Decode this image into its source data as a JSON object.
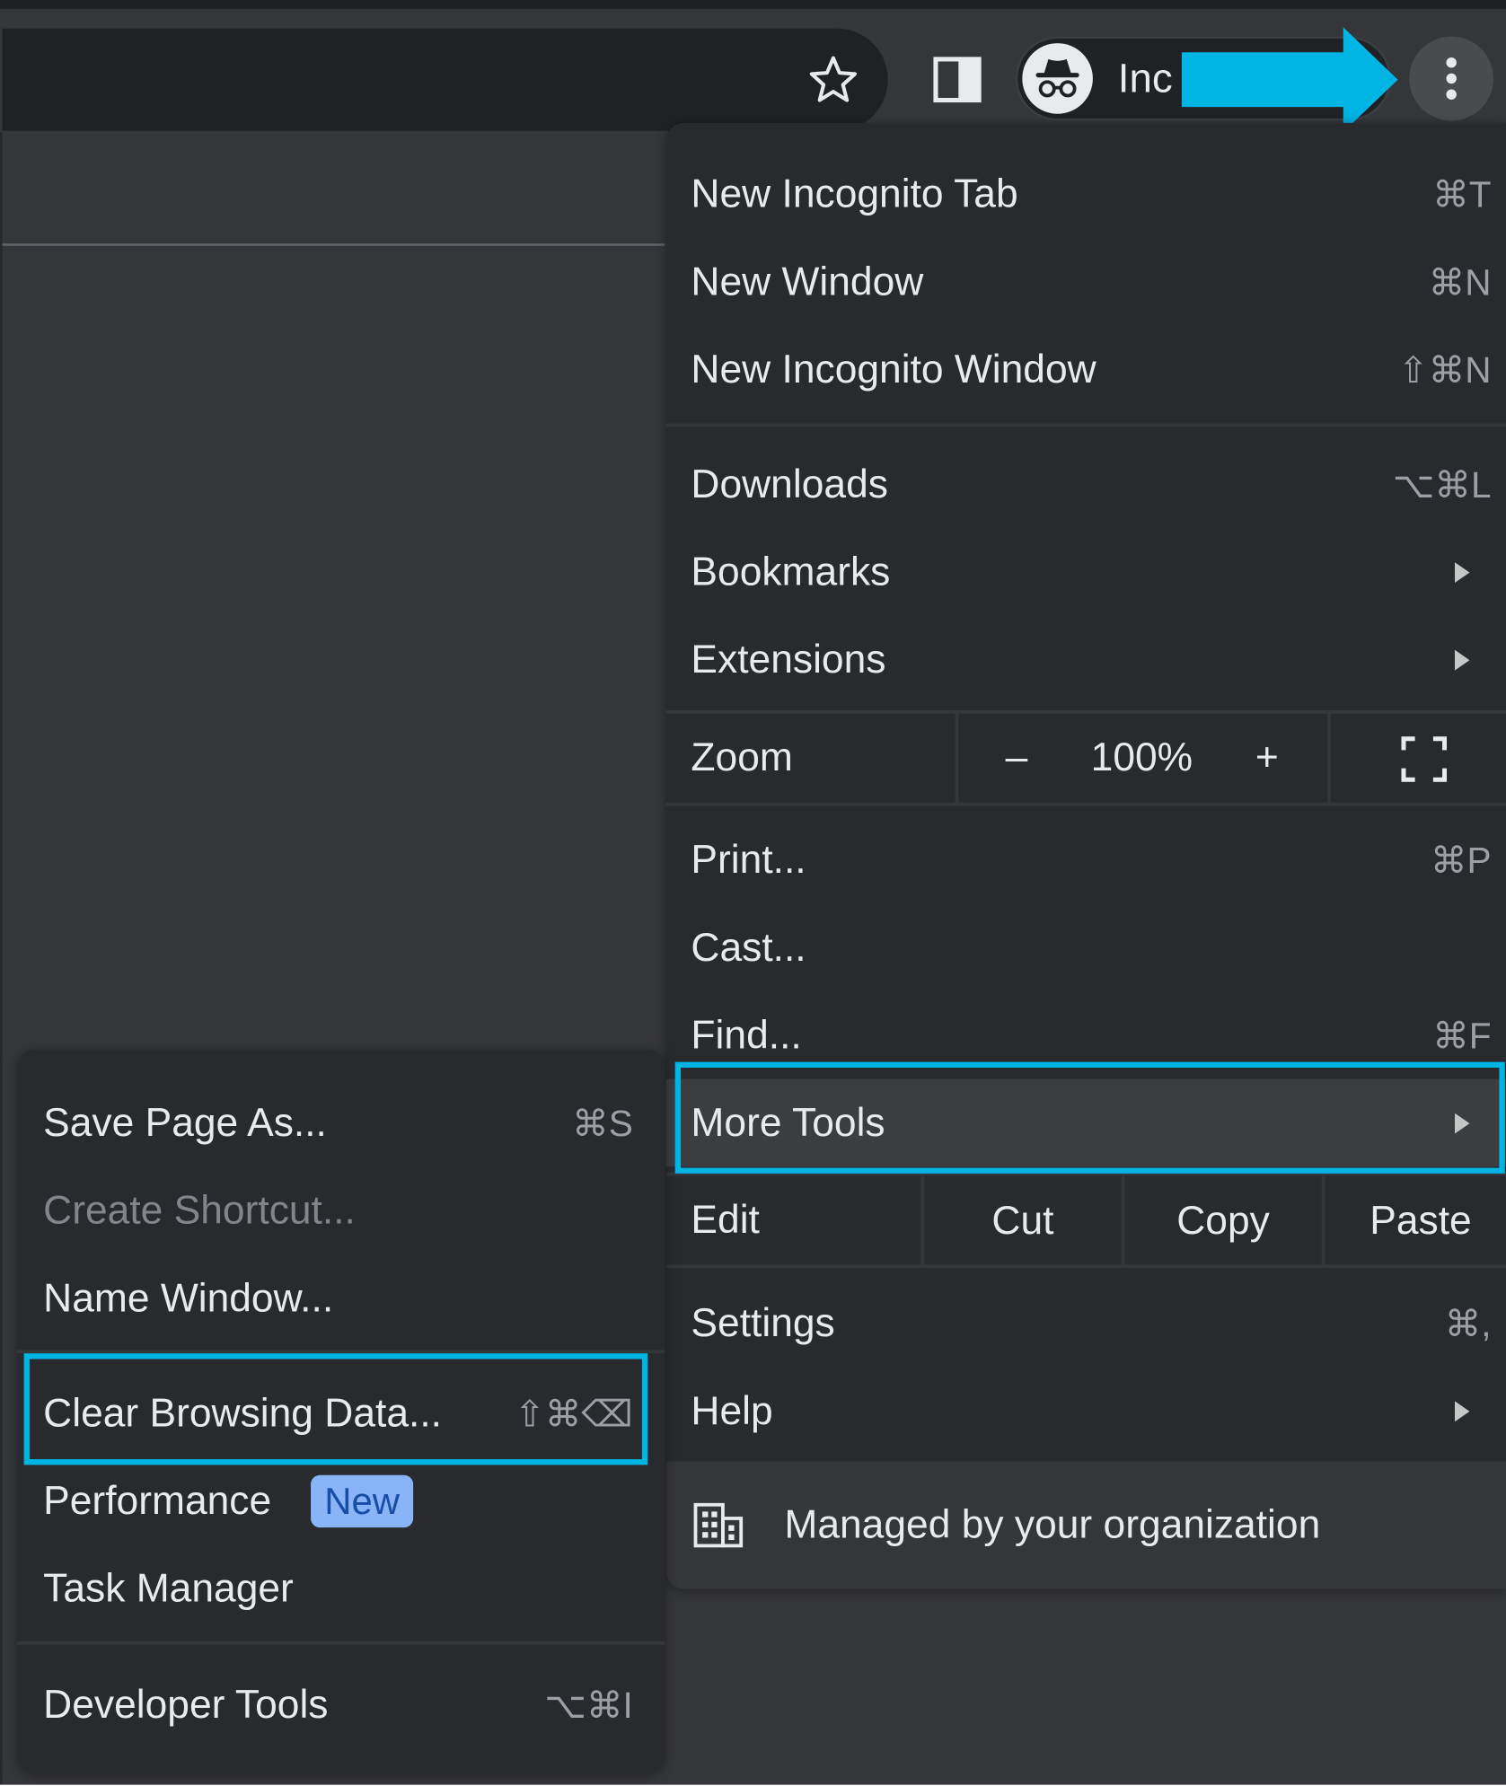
{
  "toolbar": {
    "profile_label": "Inc",
    "icons": [
      "star-icon",
      "side-panel-icon",
      "incognito-icon",
      "three-dot-menu-icon"
    ]
  },
  "main_menu": {
    "items": [
      {
        "label": "New Incognito Tab",
        "shortcut": "⌘T"
      },
      {
        "label": "New Window",
        "shortcut": "⌘N"
      },
      {
        "label": "New Incognito Window",
        "shortcut": "⇧⌘N"
      },
      {
        "label": "Downloads",
        "shortcut": "⌥⌘L"
      },
      {
        "label": "Bookmarks"
      },
      {
        "label": "Extensions"
      }
    ],
    "zoom": {
      "label": "Zoom",
      "minus": "–",
      "value": "100%",
      "plus": "+"
    },
    "items2": [
      {
        "label": "Print...",
        "shortcut": "⌘P"
      },
      {
        "label": "Cast..."
      },
      {
        "label": "Find...",
        "shortcut": "⌘F"
      },
      {
        "label": "More Tools"
      }
    ],
    "edit": {
      "label": "Edit",
      "cut": "Cut",
      "copy": "Copy",
      "paste": "Paste"
    },
    "items3": [
      {
        "label": "Settings",
        "shortcut": "⌘,"
      },
      {
        "label": "Help"
      }
    ],
    "managed": "Managed by your organization"
  },
  "more_tools_menu": {
    "items": [
      {
        "label": "Save Page As...",
        "shortcut": "⌘S"
      },
      {
        "label": "Create Shortcut..."
      },
      {
        "label": "Name Window..."
      },
      {
        "label": "Clear Browsing Data...",
        "shortcut": "⇧⌘⌫"
      },
      {
        "label": "Performance",
        "badge": "New"
      },
      {
        "label": "Task Manager"
      },
      {
        "label": "Developer Tools",
        "shortcut": "⌥⌘I"
      }
    ]
  },
  "colors": {
    "highlight": "#00b4e4",
    "menu_bg": "#292a2d",
    "text": "#e8eaed",
    "badge_bg": "#8ab4f8"
  }
}
